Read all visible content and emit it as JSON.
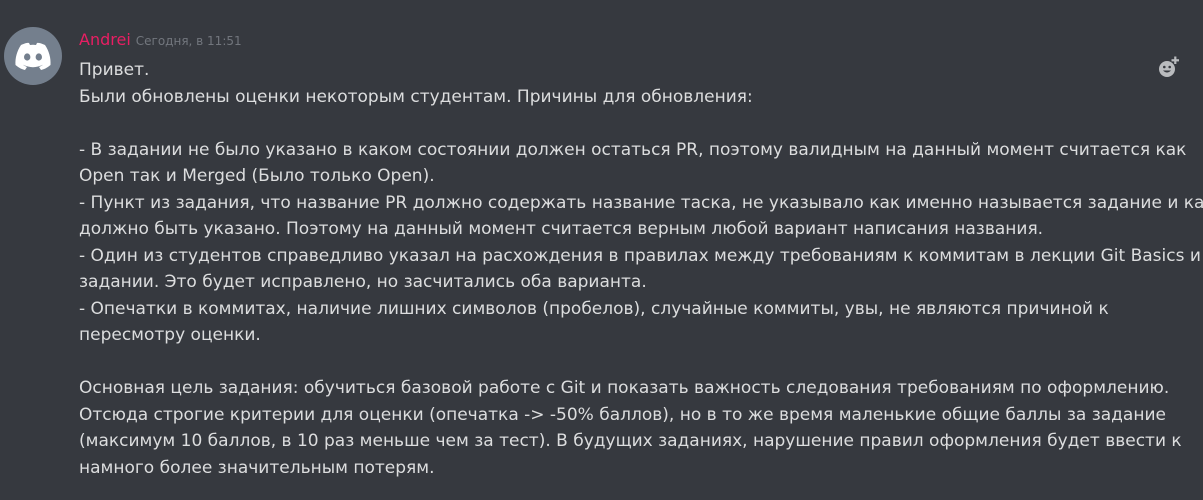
{
  "message": {
    "author": "Andrei",
    "timestamp": "Сегодня, в 11:51",
    "author_color": "#e91e63",
    "avatar_icon": "discord-logo-icon",
    "reaction_icon": "add-reaction-icon",
    "lines": [
      "Привет.",
      "Были обновлены оценки некоторым студентам. Причины для обновления:",
      "",
      "- В задании не было указано в каком состоянии должен остаться PR, поэтому валидным на данный момент считается как",
      "Open так и Merged (Было только Open).",
      "- Пункт из задания, что название PR должно содержать название таска, не указывало как именно называется задание и как",
      "должно быть указано. Поэтому на данный момент считается верным любой вариант написания названия.",
      "- Один из студентов справедливо указал на расхождения в правилах между требованиям к коммитам в лекции Git Basics и",
      "задании. Это будет исправлено, но засчитались оба варианта.",
      "- Опечатки в коммитах, наличие лишних символов (пробелов), случайные коммиты, увы, не являются причиной к",
      "пересмотру оценки.",
      "",
      "Основная цель задания: обучиться базовой работе с Git и показать важность следования требованиям по оформлению.",
      "Отсюда строгие критерии для оценки (опечатка -> -50% баллов), но в то же время маленькие общие баллы за задание",
      "(максимум 10 баллов, в 10 раз меньше чем за тест). В будущих заданиях, нарушение правил оформления будет ввести к",
      "намного более значительным потерям."
    ]
  }
}
